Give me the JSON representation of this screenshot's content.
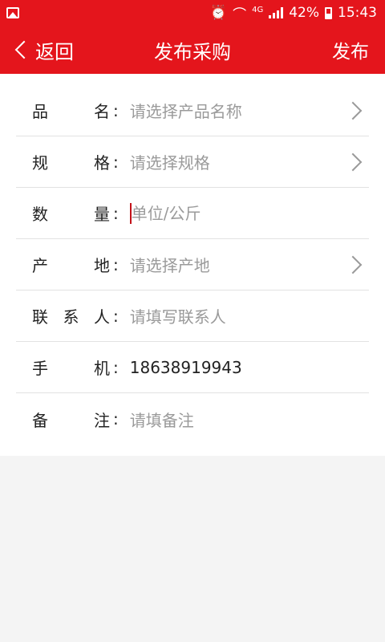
{
  "status_bar": {
    "net_type": "4G",
    "battery": "42%",
    "time": "15:43",
    "icons": [
      "image-icon",
      "alarm-icon",
      "wifi-icon",
      "signal-icon",
      "battery-icon"
    ]
  },
  "header": {
    "back_label": "返回",
    "title": "发布采购",
    "publish_label": "发布"
  },
  "form": {
    "rows": [
      {
        "label": "品名",
        "placeholder": "请选择产品名称",
        "value": "",
        "has_arrow": true
      },
      {
        "label": "规格",
        "placeholder": "请选择规格",
        "value": "",
        "has_arrow": true
      },
      {
        "label": "数量",
        "placeholder": "单位/公斤",
        "value": "",
        "has_arrow": false
      },
      {
        "label": "产地",
        "placeholder": "请选择产地",
        "value": "",
        "has_arrow": true
      },
      {
        "label": "联系人",
        "placeholder": "请填写联系人",
        "value": "",
        "has_arrow": false
      },
      {
        "label": "手机",
        "placeholder": "",
        "value": "18638919943",
        "has_arrow": false
      },
      {
        "label": "备注",
        "placeholder": "请填备注",
        "value": "",
        "has_arrow": false
      }
    ]
  },
  "colors": {
    "brand": "#e4151c",
    "placeholder": "#9a9a9a",
    "text": "#222222"
  }
}
